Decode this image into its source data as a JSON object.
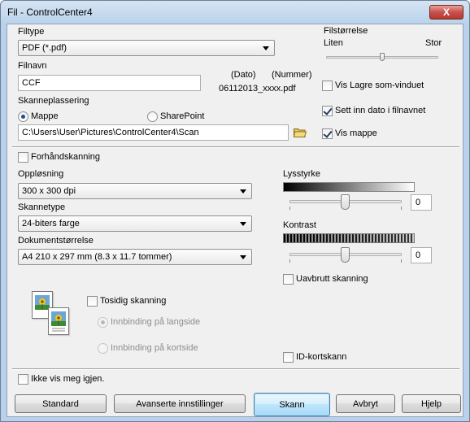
{
  "window": {
    "title": "Fil - ControlCenter4",
    "close_glyph": "X"
  },
  "filetype": {
    "label": "Filtype",
    "value": "PDF (*.pdf)"
  },
  "filesize": {
    "label": "Filstørrelse",
    "min_label": "Liten",
    "max_label": "Stor"
  },
  "filename": {
    "label": "Filnavn",
    "value": "CCF",
    "date_header": "(Dato)",
    "number_header": "(Nummer)",
    "preview": "06112013_xxxx.pdf"
  },
  "options": {
    "show_save_as": {
      "label": "Vis Lagre som-vinduet",
      "checked": false
    },
    "insert_date": {
      "label": "Sett inn dato i filnavnet",
      "checked": true
    },
    "show_folder": {
      "label": "Vis mappe",
      "checked": true
    }
  },
  "scan_location": {
    "label": "Skanneplassering",
    "folder_option": "Mappe",
    "sharepoint_option": "SharePoint",
    "selected": "Mappe",
    "path": "C:\\Users\\User\\Pictures\\ControlCenter4\\Scan"
  },
  "prescan": {
    "label": "Forhåndskanning",
    "checked": false
  },
  "resolution": {
    "label": "Oppløsning",
    "value": "300 x 300 dpi"
  },
  "scan_type": {
    "label": "Skannetype",
    "value": "24-biters farge"
  },
  "doc_size": {
    "label": "Dokumentstørrelse",
    "value": "A4 210 x 297 mm (8.3 x 11.7 tommer)"
  },
  "brightness": {
    "label": "Lysstyrke",
    "value": "0"
  },
  "contrast": {
    "label": "Kontrast",
    "value": "0"
  },
  "continuous": {
    "label": "Uavbrutt skanning",
    "checked": false
  },
  "duplex": {
    "label": "Tosidig skanning",
    "checked": false,
    "long_edge": "Innbinding på langside",
    "short_edge": "Innbinding på kortside"
  },
  "id_card": {
    "label": "ID-kortskann",
    "checked": false
  },
  "dont_show": {
    "label": "Ikke vis meg igjen.",
    "checked": false
  },
  "buttons": {
    "default": "Standard",
    "advanced": "Avanserte innstillinger",
    "scan": "Skann",
    "cancel": "Avbryt",
    "help": "Hjelp"
  }
}
